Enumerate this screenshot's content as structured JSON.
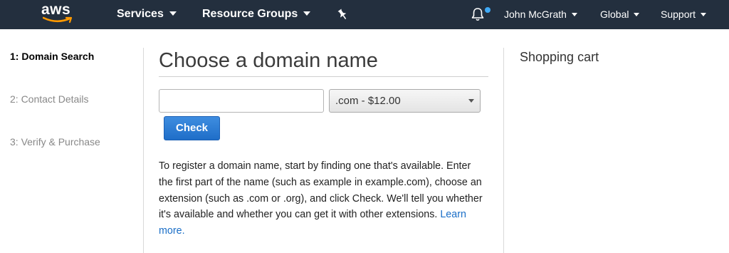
{
  "nav": {
    "logo": "aws",
    "services": "Services",
    "resource_groups": "Resource Groups",
    "user": "John McGrath",
    "region": "Global",
    "support": "Support"
  },
  "colors": {
    "topbar": "#232f3e",
    "logo_smile": "#ff9900",
    "notification_dot": "#3fa9f5",
    "primary_button": "#1f6ec8",
    "link": "#1a6ec7"
  },
  "icons": [
    "pin-icon",
    "bell-icon",
    "chevron-down-icon"
  ],
  "steps": [
    {
      "label": "1: Domain Search",
      "active": true
    },
    {
      "label": "2: Contact Details",
      "active": false
    },
    {
      "label": "3: Verify & Purchase",
      "active": false
    }
  ],
  "main": {
    "title": "Choose a domain name",
    "domain_input_value": "",
    "domain_input_placeholder": "",
    "tld_selected": ".com - $12.00",
    "check_label": "Check",
    "description": "To register a domain name, start by finding one that's available. Enter the first part of the name (such as example in example.com), choose an extension (such as .com or .org), and click Check. We'll tell you whether it's available and whether you can get it with other extensions. ",
    "learn_more": "Learn more."
  },
  "cart": {
    "title": "Shopping cart"
  }
}
